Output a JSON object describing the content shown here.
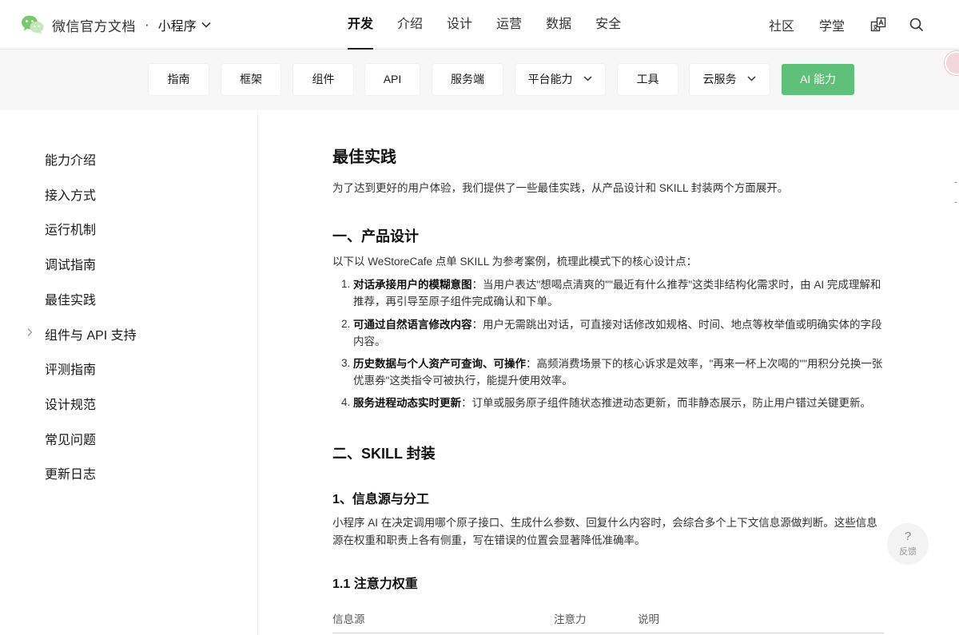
{
  "brand": {
    "name": "微信官方文档",
    "separator": "·",
    "product": "小程序"
  },
  "main_nav": [
    {
      "label": "开发",
      "active": true
    },
    {
      "label": "介绍"
    },
    {
      "label": "设计"
    },
    {
      "label": "运营"
    },
    {
      "label": "数据"
    },
    {
      "label": "安全"
    }
  ],
  "right_nav": {
    "community": "社区",
    "academy": "学堂"
  },
  "sub_nav": [
    {
      "label": "指南"
    },
    {
      "label": "框架"
    },
    {
      "label": "组件"
    },
    {
      "label": "API"
    },
    {
      "label": "服务端"
    },
    {
      "label": "平台能力",
      "dropdown": true
    },
    {
      "label": "工具"
    },
    {
      "label": "云服务",
      "dropdown": true
    },
    {
      "label": "AI 能力",
      "active": true
    }
  ],
  "sidebar": {
    "items": [
      {
        "label": "能力介绍"
      },
      {
        "label": "接入方式"
      },
      {
        "label": "运行机制"
      },
      {
        "label": "调试指南"
      },
      {
        "label": "最佳实践"
      },
      {
        "label": "组件与 API 支持",
        "expandable": true
      },
      {
        "label": "评测指南"
      },
      {
        "label": "设计规范"
      },
      {
        "label": "常见问题"
      },
      {
        "label": "更新日志"
      }
    ]
  },
  "content": {
    "title": "最佳实践",
    "intro": "为了达到更好的用户体验，我们提供了一些最佳实践，从产品设计和 SKILL 封装两个方面展开。",
    "section1": {
      "heading": "一、产品设计",
      "lead": "以下以 WeStoreCafe 点单 SKILL 为参考案例，梳理此模式下的核心设计点：",
      "items": [
        {
          "num": "1.",
          "bold": "对话承接用户的模糊意图",
          "text": "：当用户表达\"想喝点清爽的\"\"最近有什么推荐\"这类非结构化需求时，由 AI 完成理解和推荐，再引导至原子组件完成确认和下单。"
        },
        {
          "num": "2.",
          "bold": "可通过自然语言修改内容",
          "text": "：用户无需跳出对话，可直接对话修改如规格、时间、地点等枚举值或明确实体的字段内容。"
        },
        {
          "num": "3.",
          "bold": "历史数据与个人资产可查询、可操作",
          "text": "：高频消费场景下的核心诉求是效率，\"再来一杯上次喝的\"\"用积分兑换一张优惠券\"这类指令可被执行，能提升使用效率。"
        },
        {
          "num": "4.",
          "bold": "服务进程动态实时更新",
          "text": "：订单或服务原子组件随状态推进动态更新，而非静态展示，防止用户错过关键更新。"
        }
      ]
    },
    "section2": {
      "heading": "二、SKILL 封装",
      "sub1": {
        "heading": "1、信息源与分工",
        "para_line1": "小程序 AI 在决定调用哪个原子接口、生成什么参数、回复什么内容时，会综合多个上下文信息源做判断。这些信息",
        "para_line2": "源在权重和职责上各有侧重，写在错误的位置会显著降低准确率。"
      },
      "sub11": {
        "heading": "1.1 注意力权重",
        "table_headers": [
          "信息源",
          "注意力",
          "说明"
        ]
      }
    }
  },
  "feedback": {
    "symbol": "?",
    "label": "反馈"
  },
  "colors": {
    "accent": "#5fc07a",
    "sub_nav_bg": "#f7f7f7",
    "text": "#191919"
  },
  "icons": {
    "brand_logo": "wechat-logo-icon",
    "product_dropdown": "chevron-down-icon",
    "language": "language-switch-icon",
    "search": "search-icon",
    "expand": "chevron-right-icon"
  }
}
